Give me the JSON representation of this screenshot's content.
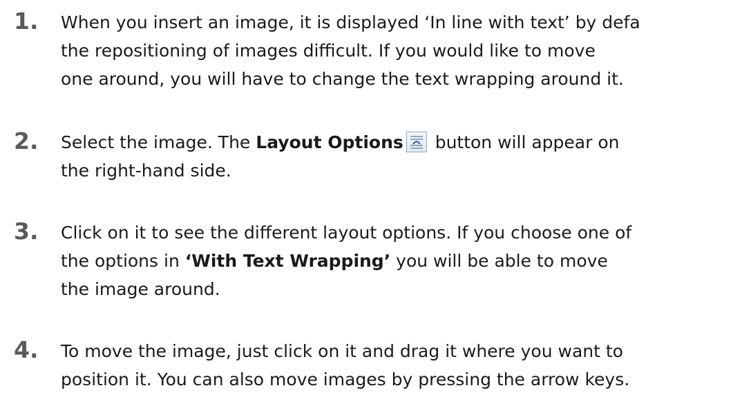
{
  "steps": [
    {
      "number": "1.",
      "lines": [
        "When you insert an image, it is displayed ‘In line with text’ by defa",
        "the repositioning of images difficult. If you would like to move",
        "one around, you will have to change the text wrapping around it."
      ]
    },
    {
      "number": "2.",
      "line1_before": "Select the image. The ",
      "line1_bold": "Layout Options",
      "line1_after": " button will appear on",
      "line2": "the right-hand side."
    },
    {
      "number": "3.",
      "line1": "Click on it to see the different layout options. If you choose one of",
      "line2_before": "the options in ",
      "line2_bold": "‘With Text Wrapping’",
      "line2_after": " you will be able to move",
      "line3": "the image around."
    },
    {
      "number": "4.",
      "lines": [
        "To move the image, just click on it and drag it where you want to",
        "position it. You can also move images by pressing the arrow keys."
      ]
    }
  ],
  "icons": {
    "layout_options": "layout-options-icon"
  },
  "colors": {
    "text": "#1a1a1a",
    "step_number": "#5a5a5a",
    "icon_border": "#8aa8c8",
    "icon_accent": "#2f6db3"
  }
}
